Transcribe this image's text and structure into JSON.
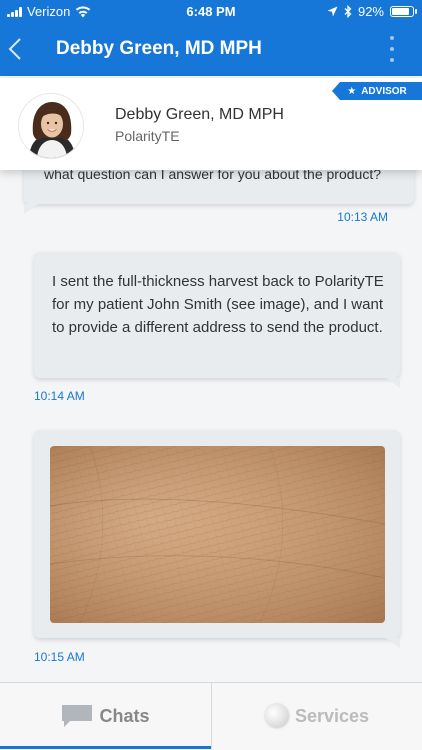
{
  "status_bar": {
    "carrier": "Verizon",
    "time": "6:48 PM",
    "battery": "92%",
    "battery_level": 0.92,
    "icons": [
      "signal-icon",
      "wifi-icon",
      "location-arrow-icon",
      "bluetooth-icon",
      "battery-icon"
    ]
  },
  "nav": {
    "back_icon": "back-chevron-icon",
    "title": "Debby Green, MD MPH",
    "more_icon": "more-vertical-icon"
  },
  "advisor_card": {
    "name": "Debby Green, MD MPH",
    "organization": "PolarityTE",
    "badge": "ADVISOR",
    "badge_icon": "star-icon"
  },
  "messages": [
    {
      "text": "what question can I answer for you about the product?",
      "time": "10:13 AM"
    },
    {
      "text": "I sent the full-thickness harvest back to PolarityTE for my patient John Smith (see image), and I want to provide a different address to send the product.",
      "time": "10:14 AM"
    },
    {
      "image": "skin-photo",
      "time": "10:15 AM"
    }
  ],
  "tabs": [
    {
      "label": "Chats",
      "icon": "chat-bubble-icon",
      "active": true
    },
    {
      "label": "Services",
      "icon": "services-icon",
      "active": false
    }
  ],
  "colors": {
    "brand": "#1677d8",
    "bubble": "#e8ecef",
    "timestamp": "#1677d8"
  }
}
